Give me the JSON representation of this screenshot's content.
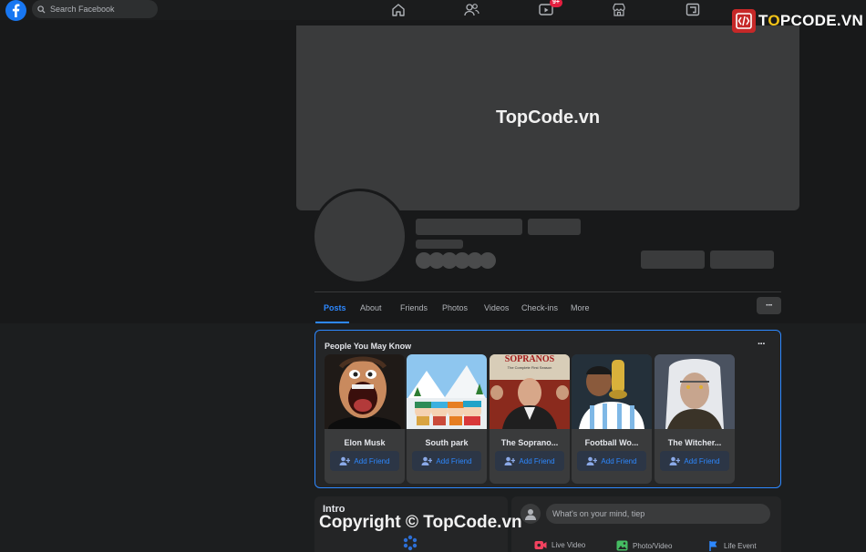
{
  "topbar": {
    "search_placeholder": "Search Facebook",
    "watch_badge": "9+",
    "nav_icons": [
      "home-icon",
      "friends-icon",
      "watch-icon",
      "marketplace-icon",
      "groups-icon"
    ]
  },
  "watermark": {
    "brand": "TOPCODE.VN",
    "brand_letter_1": "T",
    "brand_letter_2": "O",
    "brand_letter_3": "PCODE.VN",
    "cover_text": "TopCode.vn",
    "copyright": "Copyright © TopCode.vn"
  },
  "profile_tabs": [
    {
      "label": "Posts",
      "active": true
    },
    {
      "label": "About"
    },
    {
      "label": "Friends"
    },
    {
      "label": "Photos"
    },
    {
      "label": "Videos"
    },
    {
      "label": "Check-ins"
    },
    {
      "label": "More"
    }
  ],
  "tabs_more_button": "···",
  "pymk": {
    "title": "People You May Know",
    "menu": "···",
    "people": [
      {
        "name": "Elon Musk",
        "action": "Add Friend"
      },
      {
        "name": "South park",
        "action": "Add Friend"
      },
      {
        "name": "The Soprano...",
        "action": "Add Friend"
      },
      {
        "name": "Football Wo...",
        "action": "Add Friend"
      },
      {
        "name": "The Witcher...",
        "action": "Add Friend"
      }
    ],
    "sopranos_header": "SOPRANOS",
    "sopranos_sub": "The Complete First Season"
  },
  "intro": {
    "title": "Intro"
  },
  "composer": {
    "placeholder": "What's on your mind, tiep",
    "options": [
      {
        "label": "Live Video",
        "color": "#f3425f"
      },
      {
        "label": "Photo/Video",
        "color": "#45bd62"
      },
      {
        "label": "Life Event",
        "color": "#2d88ff"
      }
    ]
  },
  "colors": {
    "accent": "#2d88ff",
    "background": "#18191a",
    "card": "#242526",
    "badge": "#e41e3f",
    "brand_red": "#c62828"
  }
}
